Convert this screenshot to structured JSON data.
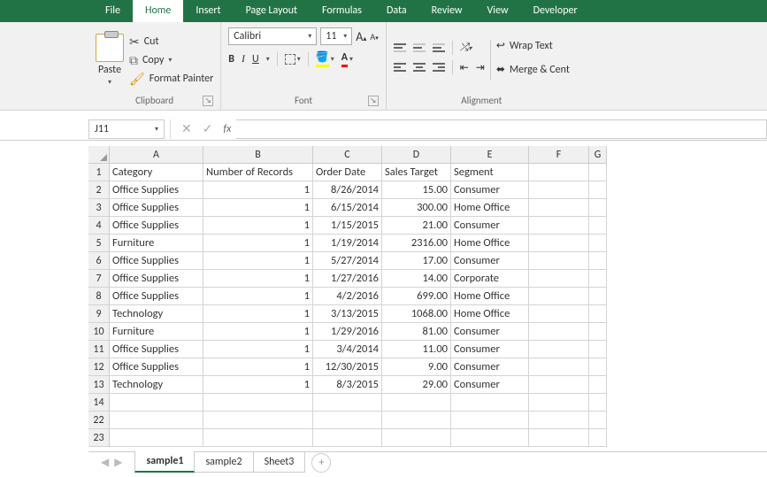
{
  "menubar": {
    "tabs": [
      "File",
      "Home",
      "Insert",
      "Page Layout",
      "Formulas",
      "Data",
      "Review",
      "View",
      "Developer"
    ],
    "active_index": 1
  },
  "ribbon": {
    "clipboard": {
      "paste": "Paste",
      "cut": "Cut",
      "copy": "Copy",
      "format_painter": "Format Painter",
      "group_label": "Clipboard"
    },
    "font": {
      "font_name": "Calibri",
      "font_size": "11",
      "bold": "B",
      "italic": "I",
      "underline": "U",
      "font_color_letter": "A",
      "group_label": "Font"
    },
    "alignment": {
      "wrap_text": "Wrap Text",
      "merge_center": "Merge & Cent",
      "group_label": "Alignment"
    }
  },
  "name_box": "J11",
  "fx": "fx",
  "columns": [
    "A",
    "B",
    "C",
    "D",
    "E",
    "F",
    "G"
  ],
  "row_numbers": [
    "1",
    "2",
    "3",
    "4",
    "5",
    "6",
    "7",
    "8",
    "9",
    "10",
    "11",
    "12",
    "13",
    "14",
    "22",
    "23"
  ],
  "headers": {
    "A": "Category",
    "B": "Number of Records",
    "C": "Order Date",
    "D": "Sales Target",
    "E": "Segment"
  },
  "rows": [
    {
      "A": "Office Supplies",
      "B": "1",
      "C": "8/26/2014",
      "D": "15.00",
      "E": "Consumer"
    },
    {
      "A": "Office Supplies",
      "B": "1",
      "C": "6/15/2014",
      "D": "300.00",
      "E": "Home Office"
    },
    {
      "A": "Office Supplies",
      "B": "1",
      "C": "1/15/2015",
      "D": "21.00",
      "E": "Consumer"
    },
    {
      "A": "Furniture",
      "B": "1",
      "C": "1/19/2014",
      "D": "2316.00",
      "E": "Home Office"
    },
    {
      "A": "Office Supplies",
      "B": "1",
      "C": "5/27/2014",
      "D": "17.00",
      "E": "Consumer"
    },
    {
      "A": "Office Supplies",
      "B": "1",
      "C": "1/27/2016",
      "D": "14.00",
      "E": "Corporate"
    },
    {
      "A": "Office Supplies",
      "B": "1",
      "C": "4/2/2016",
      "D": "699.00",
      "E": "Home Office"
    },
    {
      "A": "Technology",
      "B": "1",
      "C": "3/13/2015",
      "D": "1068.00",
      "E": "Home Office"
    },
    {
      "A": "Furniture",
      "B": "1",
      "C": "1/29/2016",
      "D": "81.00",
      "E": "Consumer"
    },
    {
      "A": "Office Supplies",
      "B": "1",
      "C": "3/4/2014",
      "D": "11.00",
      "E": "Consumer"
    },
    {
      "A": "Office Supplies",
      "B": "1",
      "C": "12/30/2015",
      "D": "9.00",
      "E": "Consumer"
    },
    {
      "A": "Technology",
      "B": "1",
      "C": "8/3/2015",
      "D": "29.00",
      "E": "Consumer"
    }
  ],
  "sheet_tabs": [
    "sample1",
    "sample2",
    "Sheet3"
  ],
  "active_sheet_index": 0
}
